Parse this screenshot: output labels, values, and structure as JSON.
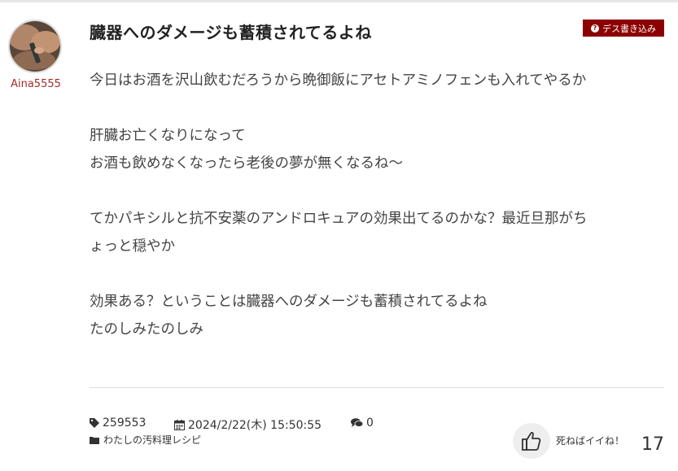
{
  "post": {
    "username": "Aina5555",
    "title": "臓器へのダメージも蓄積されてるよね",
    "tag": "デス書き込み",
    "paragraphs": [
      [
        "今日はお酒を沢山飲むだろうから晩御飯にアセトアミノフェンも入れてやるか"
      ],
      [
        "肝臓お亡くなりになって",
        "お酒も飲めなくなったら老後の夢が無くなるね〜"
      ],
      [
        "てかパキシルと抗不安薬のアンドロキュアの効果出てるのかな？最近旦那がち",
        "ょっと穏やか"
      ],
      [
        "効果ある？ということは臓器へのダメージも蓄積されてるよね",
        "たのしみたのしみ"
      ]
    ]
  },
  "meta": {
    "id": "259553",
    "datetime": "2024/2/22(木) 15:50:55",
    "comments": "0",
    "category": "わたしの汚料理レシピ"
  },
  "like": {
    "label": "死ねばイイね！",
    "count": "17"
  },
  "icons": {
    "tag": "question-circle-icon",
    "id": "tag-icon",
    "date": "calendar-icon",
    "comments": "comments-icon",
    "category": "folder-icon",
    "like": "thumbs-up-icon"
  },
  "colors": {
    "tag_bg": "#8b0000",
    "username": "#a52a2a"
  }
}
